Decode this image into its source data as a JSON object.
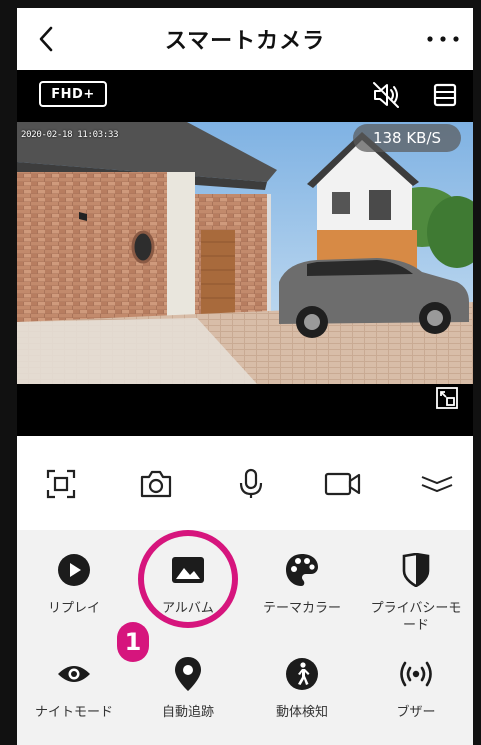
{
  "header": {
    "title": "スマートカメラ",
    "back_icon": "chevron-left-icon",
    "more_icon": "more-dots-icon"
  },
  "video_toolbar": {
    "quality_label": "FHD+",
    "mute_icon": "speaker-muted-icon",
    "layout_icon": "layout-icon"
  },
  "video": {
    "timestamp": "2020-02-18 11:03:33",
    "bitrate": "138 KB/S",
    "fullscreen_icon": "fullscreen-icon"
  },
  "controls": [
    {
      "name": "screenshot-button",
      "icon": "frame-icon"
    },
    {
      "name": "camera-button",
      "icon": "camera-icon"
    },
    {
      "name": "microphone-button",
      "icon": "microphone-icon"
    },
    {
      "name": "record-button",
      "icon": "video-camera-icon"
    },
    {
      "name": "collapse-button",
      "icon": "chevron-double-down-icon"
    }
  ],
  "features": [
    {
      "label": "リプレイ",
      "icon": "play-circle-icon"
    },
    {
      "label": "アルバム",
      "icon": "image-icon"
    },
    {
      "label": "テーマカラー",
      "icon": "palette-icon"
    },
    {
      "label": "プライバシーモード",
      "icon": "privacy-shield-icon"
    },
    {
      "label": "ナイトモード",
      "icon": "eye-icon"
    },
    {
      "label": "自動追跡",
      "icon": "location-pin-icon"
    },
    {
      "label": "動体検知",
      "icon": "walking-person-icon"
    },
    {
      "label": "ブザー",
      "icon": "buzzer-icon"
    }
  ],
  "annotation": {
    "step_number": "❶",
    "highlight_color": "#d6157d"
  },
  "colors": {
    "accent": "#d6157d",
    "toolbar_bg": "#000000",
    "grid_bg": "#f2f2f2"
  }
}
